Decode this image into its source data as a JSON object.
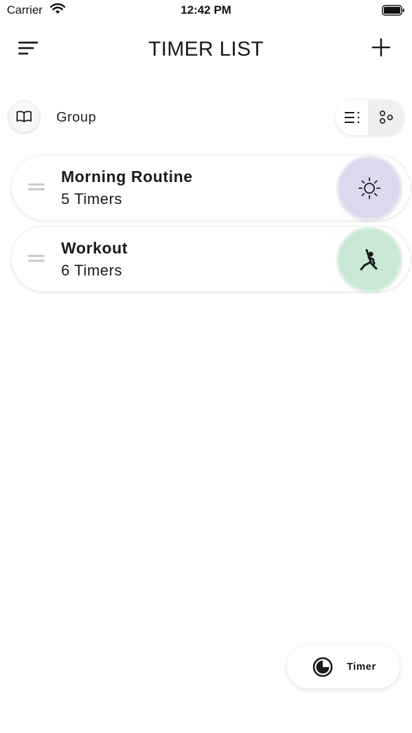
{
  "status_bar": {
    "carrier": "Carrier",
    "time": "12:42 PM"
  },
  "header": {
    "title": "TIMER LIST",
    "menu_icon": "menu-icon",
    "add_icon": "plus-icon"
  },
  "group_bar": {
    "label": "Group",
    "icon": "book-icon",
    "view_modes": [
      {
        "icon": "list-view-icon",
        "selected": false
      },
      {
        "icon": "grid-view-icon",
        "selected": true
      }
    ]
  },
  "groups": [
    {
      "title": "Morning Routine",
      "count": "5 Timers",
      "icon": "sun-icon",
      "color": "#ddd8ee"
    },
    {
      "title": "Workout",
      "count": "6 Timers",
      "icon": "stretch-icon",
      "color": "#c9e8d4"
    }
  ],
  "fab": {
    "label": "Timer",
    "icon": "timer-icon"
  }
}
